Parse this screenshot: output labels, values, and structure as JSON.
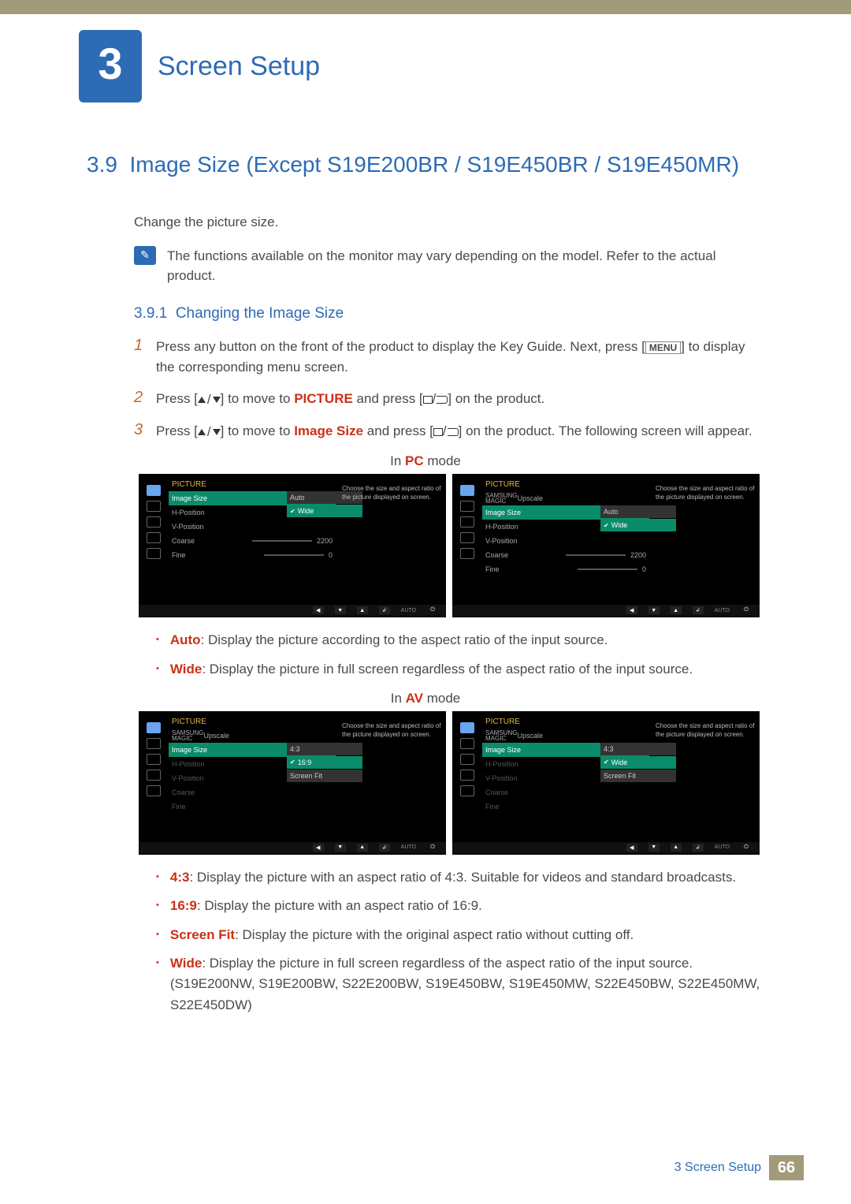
{
  "chapter": {
    "number": "3",
    "title": "Screen Setup"
  },
  "section": {
    "number": "3.9",
    "title": "Image Size (Except S19E200BR / S19E450BR / S19E450MR)"
  },
  "intro": "Change the picture size.",
  "note": "The functions available on the monitor may vary depending on the model. Refer to the actual product.",
  "subsection": {
    "number": "3.9.1",
    "title": "Changing the Image Size"
  },
  "steps": {
    "s1p1": "Press any button on the front of the product to display the Key Guide. Next, press [",
    "s1menu": "MENU",
    "s1p2": "] to display the corresponding menu screen.",
    "s2p1": "Press [",
    "s2p2": "] to move to ",
    "s2picture": "PICTURE",
    "s2p3": " and press [",
    "s2p4": "] on the product.",
    "s3p1": "Press [",
    "s3p2": "] to move to ",
    "s3img": "Image Size",
    "s3p3": " and press [",
    "s3p4": "] on the product. The following screen will appear."
  },
  "mode_pc": {
    "prefix": "In ",
    "bold": "PC",
    "suffix": " mode"
  },
  "mode_av": {
    "prefix": "In ",
    "bold": "AV",
    "suffix": " mode"
  },
  "osd": {
    "title": "PICTURE",
    "desc": "Choose the size and aspect ratio of the picture displayed on screen.",
    "magic": "Upscale",
    "auto_txt": "AUTO",
    "pc_left_items": [
      "Image Size",
      "H-Position",
      "V-Position",
      "Coarse",
      "Fine"
    ],
    "pc_left_vals": {
      "auto": "Auto",
      "wide": "Wide",
      "coarse": "2200",
      "fine": "0"
    },
    "pc_right_items": [
      "Upscale",
      "Image Size",
      "H-Position",
      "V-Position",
      "Coarse",
      "Fine"
    ],
    "av_items": [
      "Upscale",
      "Image Size",
      "H-Position",
      "V-Position",
      "Coarse",
      "Fine"
    ],
    "av_vals": {
      "r43": "4:3",
      "r169": "16:9",
      "wide": "Wide",
      "sf": "Screen Fit"
    }
  },
  "pc_bullets": {
    "auto_b": "Auto",
    "auto_t": ": Display the picture according to the aspect ratio of the input source.",
    "wide_b": "Wide",
    "wide_t": ": Display the picture in full screen regardless of the aspect ratio of the input source."
  },
  "av_bullets": {
    "r43_b": "4:3",
    "r43_t": ": Display the picture with an aspect ratio of 4:3. Suitable for videos and standard broadcasts.",
    "r169_b": "16:9",
    "r169_t": ": Display the picture with an aspect ratio of 16:9.",
    "sf_b": "Screen Fit",
    "sf_t": ": Display the picture with the original aspect ratio without cutting off.",
    "wide_b": "Wide",
    "wide_t": ": Display the picture in full screen regardless of the aspect ratio of the input source. (S19E200NW, S19E200BW, S22E200BW, S19E450BW, S19E450MW, S22E450BW, S22E450MW, S22E450DW)"
  },
  "footer": {
    "chapter_ref": "3 Screen Setup",
    "page": "66"
  }
}
